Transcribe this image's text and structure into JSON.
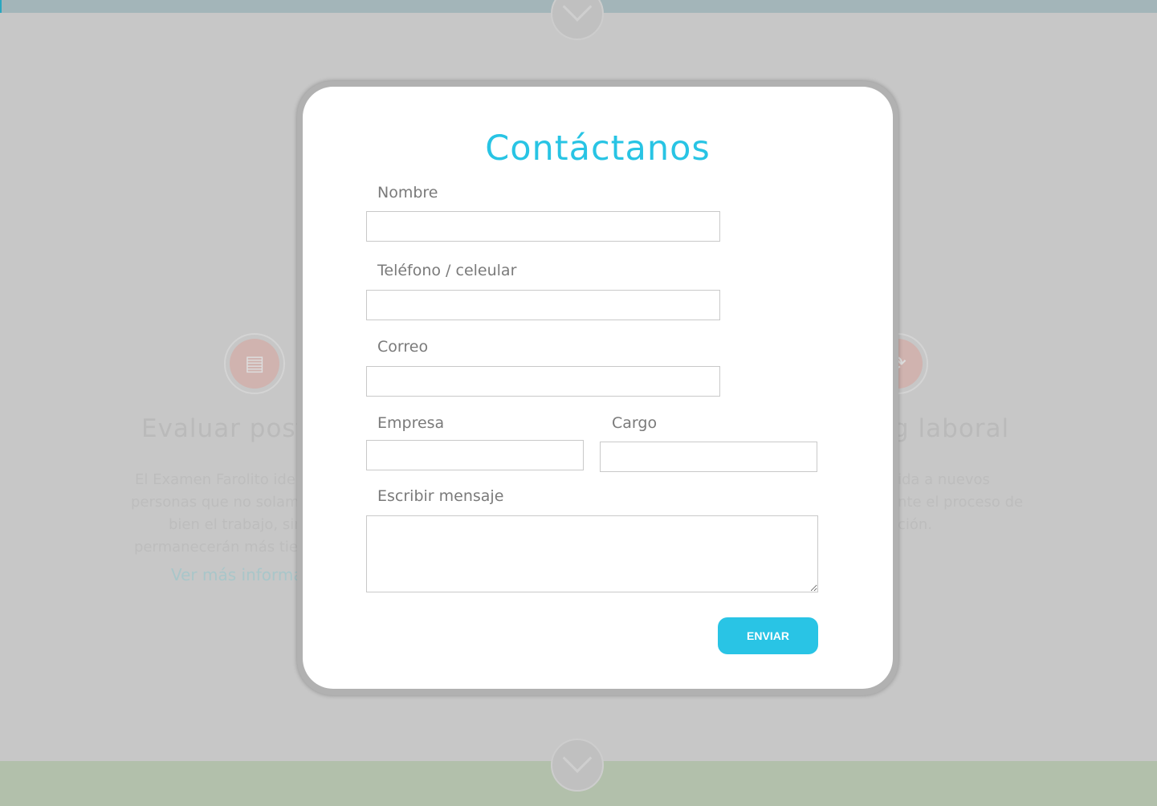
{
  "background": {
    "left_feature": {
      "title": "Evaluar postu",
      "lines": [
        "El Examen Farolito ide",
        "personas que no solam",
        "bien el trabajo, sin",
        "permanecerán más tie"
      ],
      "link": "Ver más informa"
    },
    "right_feature": {
      "title": "g laboral",
      "lines": [
        "ida a nuevos",
        "nte el proceso de",
        "ción."
      ]
    },
    "icons": [
      "document-icon",
      "people-cycle-icon",
      "chevron-down-icon"
    ]
  },
  "modal": {
    "title": "Contáctanos",
    "fields": {
      "nombre": {
        "label": "Nombre",
        "value": ""
      },
      "telefono": {
        "label": "Teléfono / celeular",
        "value": ""
      },
      "correo": {
        "label": "Correo",
        "value": ""
      },
      "empresa": {
        "label": "Empresa",
        "value": ""
      },
      "cargo": {
        "label": "Cargo",
        "value": ""
      },
      "mensaje": {
        "label": "Escribir mensaje",
        "value": ""
      }
    },
    "submit_label": "ENVIAR"
  },
  "colors": {
    "accent": "#29c4e5",
    "overlay": "#c7c7c7"
  }
}
